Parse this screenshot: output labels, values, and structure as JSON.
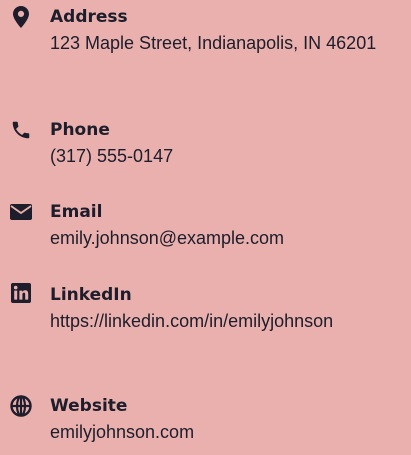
{
  "contact": {
    "items": [
      {
        "label": "Address",
        "value": "123 Maple Street, Indianapolis, IN 46201",
        "icon": "map-marker-icon"
      },
      {
        "label": "Phone",
        "value": "(317) 555-0147",
        "icon": "phone-icon"
      },
      {
        "label": "Email",
        "value": "emily.johnson@example.com",
        "icon": "envelope-icon"
      },
      {
        "label": "LinkedIn",
        "value": "https://linkedin.com/in/emilyjohnson",
        "icon": "linkedin-icon"
      },
      {
        "label": "Website",
        "value": "emilyjohnson.com",
        "icon": "globe-icon"
      }
    ]
  },
  "colors": {
    "background": "#e9b0ae",
    "text": "#1d1d2b"
  }
}
